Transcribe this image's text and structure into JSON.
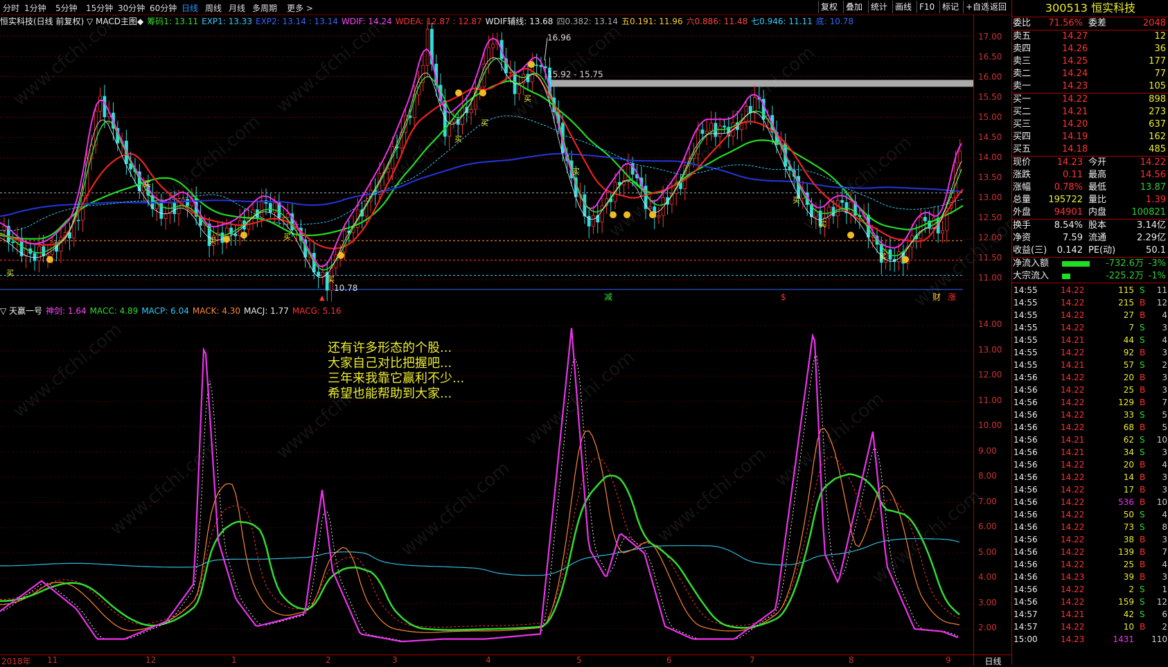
{
  "toolbar": {
    "periods": [
      {
        "label": "分时"
      },
      {
        "label": "1分钟"
      },
      {
        "label": "5分钟"
      },
      {
        "label": "15分钟"
      },
      {
        "label": "30分钟"
      },
      {
        "label": "60分钟"
      },
      {
        "label": "日线"
      },
      {
        "label": "周线"
      },
      {
        "label": "月线"
      },
      {
        "label": "多周期"
      },
      {
        "label": "更多 >"
      }
    ],
    "active_period": "日线",
    "buttons": [
      {
        "label": "复权"
      },
      {
        "label": "叠加"
      },
      {
        "label": "统计"
      },
      {
        "label": "画线"
      },
      {
        "label": "F10"
      },
      {
        "label": "标记"
      },
      {
        "label": "+自选"
      },
      {
        "label": "返回"
      }
    ]
  },
  "main_legend": {
    "title": "恒实科技(日线 前复权) ▽ MACD主图◆",
    "items": [
      {
        "text": "筹码1: 13.11",
        "color": "#33dd33"
      },
      {
        "text": "EXP1: 13.33",
        "color": "#33ccff"
      },
      {
        "text": "EXP2: 13.14 : 13.14",
        "color": "#3366ff"
      },
      {
        "text": "WDIF: 14.24",
        "color": "#ff44ff"
      },
      {
        "text": "WDEA: 12.87 : 12.87",
        "color": "#ff3333"
      },
      {
        "text": "WDIF辅线: 13.68",
        "color": "#eeeeee"
      },
      {
        "text": "四0.382: 13.14",
        "color": "#aaaaaa"
      },
      {
        "text": "五0.191: 11.96",
        "color": "#ffcc33"
      },
      {
        "text": "六0.886: 11.48",
        "color": "#ff4444"
      },
      {
        "text": "七0.946: 11.11",
        "color": "#33ccff"
      },
      {
        "text": "底: 10.78",
        "color": "#3366ff"
      }
    ]
  },
  "price_axis": {
    "labels": [
      "17.00",
      "16.50",
      "16.00",
      "15.50",
      "15.00",
      "14.50",
      "14.00",
      "13.50",
      "13.00",
      "12.50",
      "12.00",
      "11.50",
      "11.00"
    ]
  },
  "annotations": {
    "high_label": "16.96",
    "range_label": "15.92 - 15.75",
    "low_label": "10.78",
    "buy_marker": "买",
    "event_marks": [
      {
        "text": "减",
        "color": "#33dd33"
      },
      {
        "text": "$",
        "color": "#ff3333"
      },
      {
        "text": "财",
        "color": "#ffcc33"
      },
      {
        "text": "涨",
        "color": "#ff3333"
      }
    ]
  },
  "indicator_legend": {
    "title": "▽ 天赢一号",
    "items": [
      {
        "text": "神剑: 1.64",
        "color": "#ff44ff"
      },
      {
        "text": "MACC: 4.89",
        "color": "#33dd33"
      },
      {
        "text": "MACP: 6.04",
        "color": "#33ccff"
      },
      {
        "text": "MACK: 4.30",
        "color": "#ff8833"
      },
      {
        "text": "MACJ: 1.77",
        "color": "#eeeeee"
      },
      {
        "text": "MACG: 5.16",
        "color": "#ff3333"
      }
    ]
  },
  "indicator_axis": {
    "labels": [
      "14.00",
      "13.00",
      "12.00",
      "11.00",
      "10.00",
      "9.00",
      "8.00",
      "7.00",
      "6.00",
      "5.00",
      "4.00",
      "3.00",
      "2.00"
    ]
  },
  "note_lines": [
    "还有许多形态的个股...",
    "大家自己对比把握吧...",
    "三年来我靠它赢利不少...",
    "希望也能帮助到大家..."
  ],
  "date_axis": {
    "labels": [
      "2018年",
      "11",
      "12",
      "1",
      "2",
      "3",
      "4",
      "5",
      "6",
      "7",
      "8",
      "9"
    ],
    "corner": "日线"
  },
  "watermark": "www.cfchi.com",
  "stock": {
    "code": "300513",
    "name": "恒实科技"
  },
  "order_book": {
    "weibi": {
      "label": "委比",
      "value": "71.56%",
      "label2": "委差",
      "value2": "2048"
    },
    "asks": [
      {
        "label": "卖五",
        "price": "14.27",
        "vol": "12"
      },
      {
        "label": "卖四",
        "price": "14.26",
        "vol": "36"
      },
      {
        "label": "卖三",
        "price": "14.25",
        "vol": "177"
      },
      {
        "label": "卖二",
        "price": "14.24",
        "vol": "77"
      },
      {
        "label": "卖一",
        "price": "14.23",
        "vol": "105"
      }
    ],
    "bids": [
      {
        "label": "买一",
        "price": "14.22",
        "vol": "898"
      },
      {
        "label": "买二",
        "price": "14.21",
        "vol": "273"
      },
      {
        "label": "买三",
        "price": "14.20",
        "vol": "637"
      },
      {
        "label": "买四",
        "price": "14.19",
        "vol": "162"
      },
      {
        "label": "买五",
        "price": "14.18",
        "vol": "485"
      }
    ]
  },
  "quote": [
    {
      "l": "现价",
      "v": "14.23",
      "vc": "red",
      "l2": "今开",
      "v2": "14.22",
      "v2c": "red"
    },
    {
      "l": "涨跌",
      "v": "0.11",
      "vc": "red",
      "l2": "最高",
      "v2": "14.56",
      "v2c": "red"
    },
    {
      "l": "涨幅",
      "v": "0.78%",
      "vc": "red",
      "l2": "最低",
      "v2": "13.87",
      "v2c": "green"
    },
    {
      "l": "总量",
      "v": "195722",
      "vc": "yellow",
      "l2": "量比",
      "v2": "1.39",
      "v2c": "red"
    },
    {
      "l": "外盘",
      "v": "94901",
      "vc": "red",
      "l2": "内盘",
      "v2": "100821",
      "v2c": "green"
    }
  ],
  "fundamentals": [
    {
      "l": "换手",
      "v": "8.54%",
      "l2": "股本",
      "v2": "3.14亿"
    },
    {
      "l": "净资",
      "v": "7.59",
      "l2": "流通",
      "v2": "2.29亿"
    },
    {
      "l": "收益(三)",
      "v": "0.142",
      "l2": "PE(动)",
      "v2": "50.1"
    }
  ],
  "flows": [
    {
      "l": "净流入额",
      "v": "-732.6万",
      "p": "-3%",
      "bar": 0.72
    },
    {
      "l": "大宗流入",
      "v": "-225.2万",
      "p": "-1%",
      "bar": 0.22
    }
  ],
  "ticks": [
    {
      "t": "14:55",
      "p": "14.22",
      "v": "115",
      "s": "S",
      "n": "11"
    },
    {
      "t": "14:55",
      "p": "14.22",
      "v": "215",
      "s": "B",
      "n": "12"
    },
    {
      "t": "14:55",
      "p": "14.22",
      "v": "27",
      "s": "B",
      "n": "4"
    },
    {
      "t": "14:55",
      "p": "14.22",
      "v": "7",
      "s": "S",
      "n": "3"
    },
    {
      "t": "14:55",
      "p": "14.21",
      "v": "44",
      "s": "S",
      "n": "4"
    },
    {
      "t": "14:55",
      "p": "14.22",
      "v": "92",
      "s": "B",
      "n": "3"
    },
    {
      "t": "14:55",
      "p": "14.21",
      "v": "57",
      "s": "S",
      "n": "2"
    },
    {
      "t": "14:56",
      "p": "14.22",
      "v": "20",
      "s": "B",
      "n": "3"
    },
    {
      "t": "14:56",
      "p": "14.22",
      "v": "25",
      "s": "B",
      "n": "3"
    },
    {
      "t": "14:56",
      "p": "14.22",
      "v": "129",
      "s": "B",
      "n": "7"
    },
    {
      "t": "14:56",
      "p": "14.22",
      "v": "33",
      "s": "S",
      "n": "5"
    },
    {
      "t": "14:56",
      "p": "14.22",
      "v": "68",
      "s": "B",
      "n": "5"
    },
    {
      "t": "14:56",
      "p": "14.21",
      "v": "62",
      "s": "S",
      "n": "10"
    },
    {
      "t": "14:56",
      "p": "14.21",
      "v": "34",
      "s": "S",
      "n": "3"
    },
    {
      "t": "14:56",
      "p": "14.22",
      "v": "20",
      "s": "B",
      "n": "4"
    },
    {
      "t": "14:56",
      "p": "14.22",
      "v": "14",
      "s": "B",
      "n": "3"
    },
    {
      "t": "14:56",
      "p": "14.22",
      "v": "17",
      "s": "B",
      "n": "3"
    },
    {
      "t": "14:56",
      "p": "14.22",
      "v": "536",
      "s": "B",
      "n": "10"
    },
    {
      "t": "14:56",
      "p": "14.22",
      "v": "50",
      "s": "S",
      "n": "4"
    },
    {
      "t": "14:56",
      "p": "14.22",
      "v": "73",
      "s": "S",
      "n": "8"
    },
    {
      "t": "14:56",
      "p": "14.22",
      "v": "38",
      "s": "B",
      "n": "3"
    },
    {
      "t": "14:56",
      "p": "14.22",
      "v": "139",
      "s": "B",
      "n": "7"
    },
    {
      "t": "14:56",
      "p": "14.22",
      "v": "25",
      "s": "B",
      "n": "4"
    },
    {
      "t": "14:56",
      "p": "14.23",
      "v": "39",
      "s": "B",
      "n": "3"
    },
    {
      "t": "14:56",
      "p": "14.22",
      "v": "2",
      "s": "S",
      "n": "1"
    },
    {
      "t": "14:56",
      "p": "14.22",
      "v": "159",
      "s": "S",
      "n": "12"
    },
    {
      "t": "14:57",
      "p": "14.21",
      "v": "42",
      "s": "S",
      "n": "6"
    },
    {
      "t": "14:57",
      "p": "14.22",
      "v": "10",
      "s": "B",
      "n": "2"
    },
    {
      "t": "15:00",
      "p": "14.23",
      "v": "1431",
      "s": "",
      "n": "110"
    }
  ],
  "colors": {
    "up": "#ff3333",
    "down": "#33dddd",
    "accent": "#ee3"
  }
}
